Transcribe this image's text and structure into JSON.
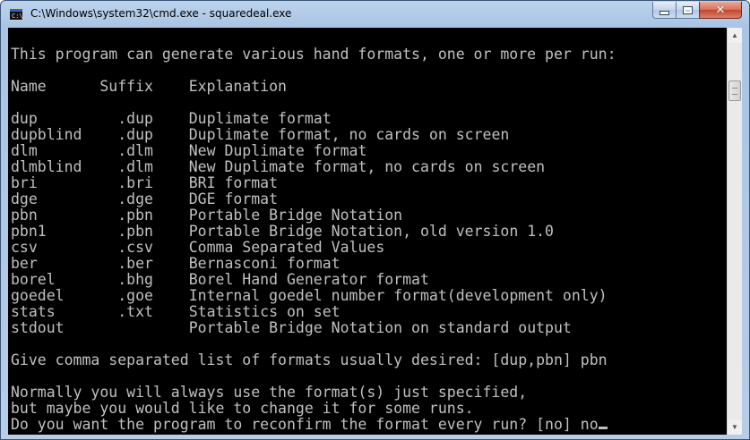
{
  "window": {
    "title": "C:\\Windows\\system32\\cmd.exe - squaredeal.exe",
    "icon_name": "cmd-icon",
    "icon_text": "C:\\"
  },
  "controls": {
    "minimize_icon": "minimize-icon",
    "maximize_icon": "maximize-icon",
    "close_icon": "close-icon",
    "close_glyph": "✕"
  },
  "console": {
    "intro": "This program can generate various hand formats, one or more per run:",
    "header": {
      "name": "Name",
      "suffix": "Suffix",
      "explanation": "Explanation"
    },
    "formats": [
      {
        "name": "dup",
        "suffix": ".dup",
        "explanation": "Duplimate format"
      },
      {
        "name": "dupblind",
        "suffix": ".dup",
        "explanation": "Duplimate format, no cards on screen"
      },
      {
        "name": "dlm",
        "suffix": ".dlm",
        "explanation": "New Duplimate format"
      },
      {
        "name": "dlmblind",
        "suffix": ".dlm",
        "explanation": "New Duplimate format, no cards on screen"
      },
      {
        "name": "bri",
        "suffix": ".bri",
        "explanation": "BRI format"
      },
      {
        "name": "dge",
        "suffix": ".dge",
        "explanation": "DGE format"
      },
      {
        "name": "pbn",
        "suffix": ".pbn",
        "explanation": "Portable Bridge Notation"
      },
      {
        "name": "pbn1",
        "suffix": ".pbn",
        "explanation": "Portable Bridge Notation, old version 1.0"
      },
      {
        "name": "csv",
        "suffix": ".csv",
        "explanation": "Comma Separated Values"
      },
      {
        "name": "ber",
        "suffix": ".ber",
        "explanation": "Bernasconi format"
      },
      {
        "name": "borel",
        "suffix": ".bhg",
        "explanation": "Borel Hand Generator format"
      },
      {
        "name": "goedel",
        "suffix": ".goe",
        "explanation": "Internal goedel number format(development only)"
      },
      {
        "name": "stats",
        "suffix": ".txt",
        "explanation": "Statistics on set"
      },
      {
        "name": "stdout",
        "suffix": "",
        "explanation": "Portable Bridge Notation on standard output"
      }
    ],
    "prompt_formats": "Give comma separated list of formats usually desired: [dup,pbn] pbn",
    "note_line1": "Normally you will always use the format(s) just specified,",
    "note_line2": "but maybe you would like to change it for some runs.",
    "prompt_reconfirm": "Do you want the program to reconfirm the format every run? [no] no"
  },
  "colors": {
    "console_bg": "#000000",
    "console_fg": "#c0c0c0",
    "close_button": "#c4472c"
  }
}
